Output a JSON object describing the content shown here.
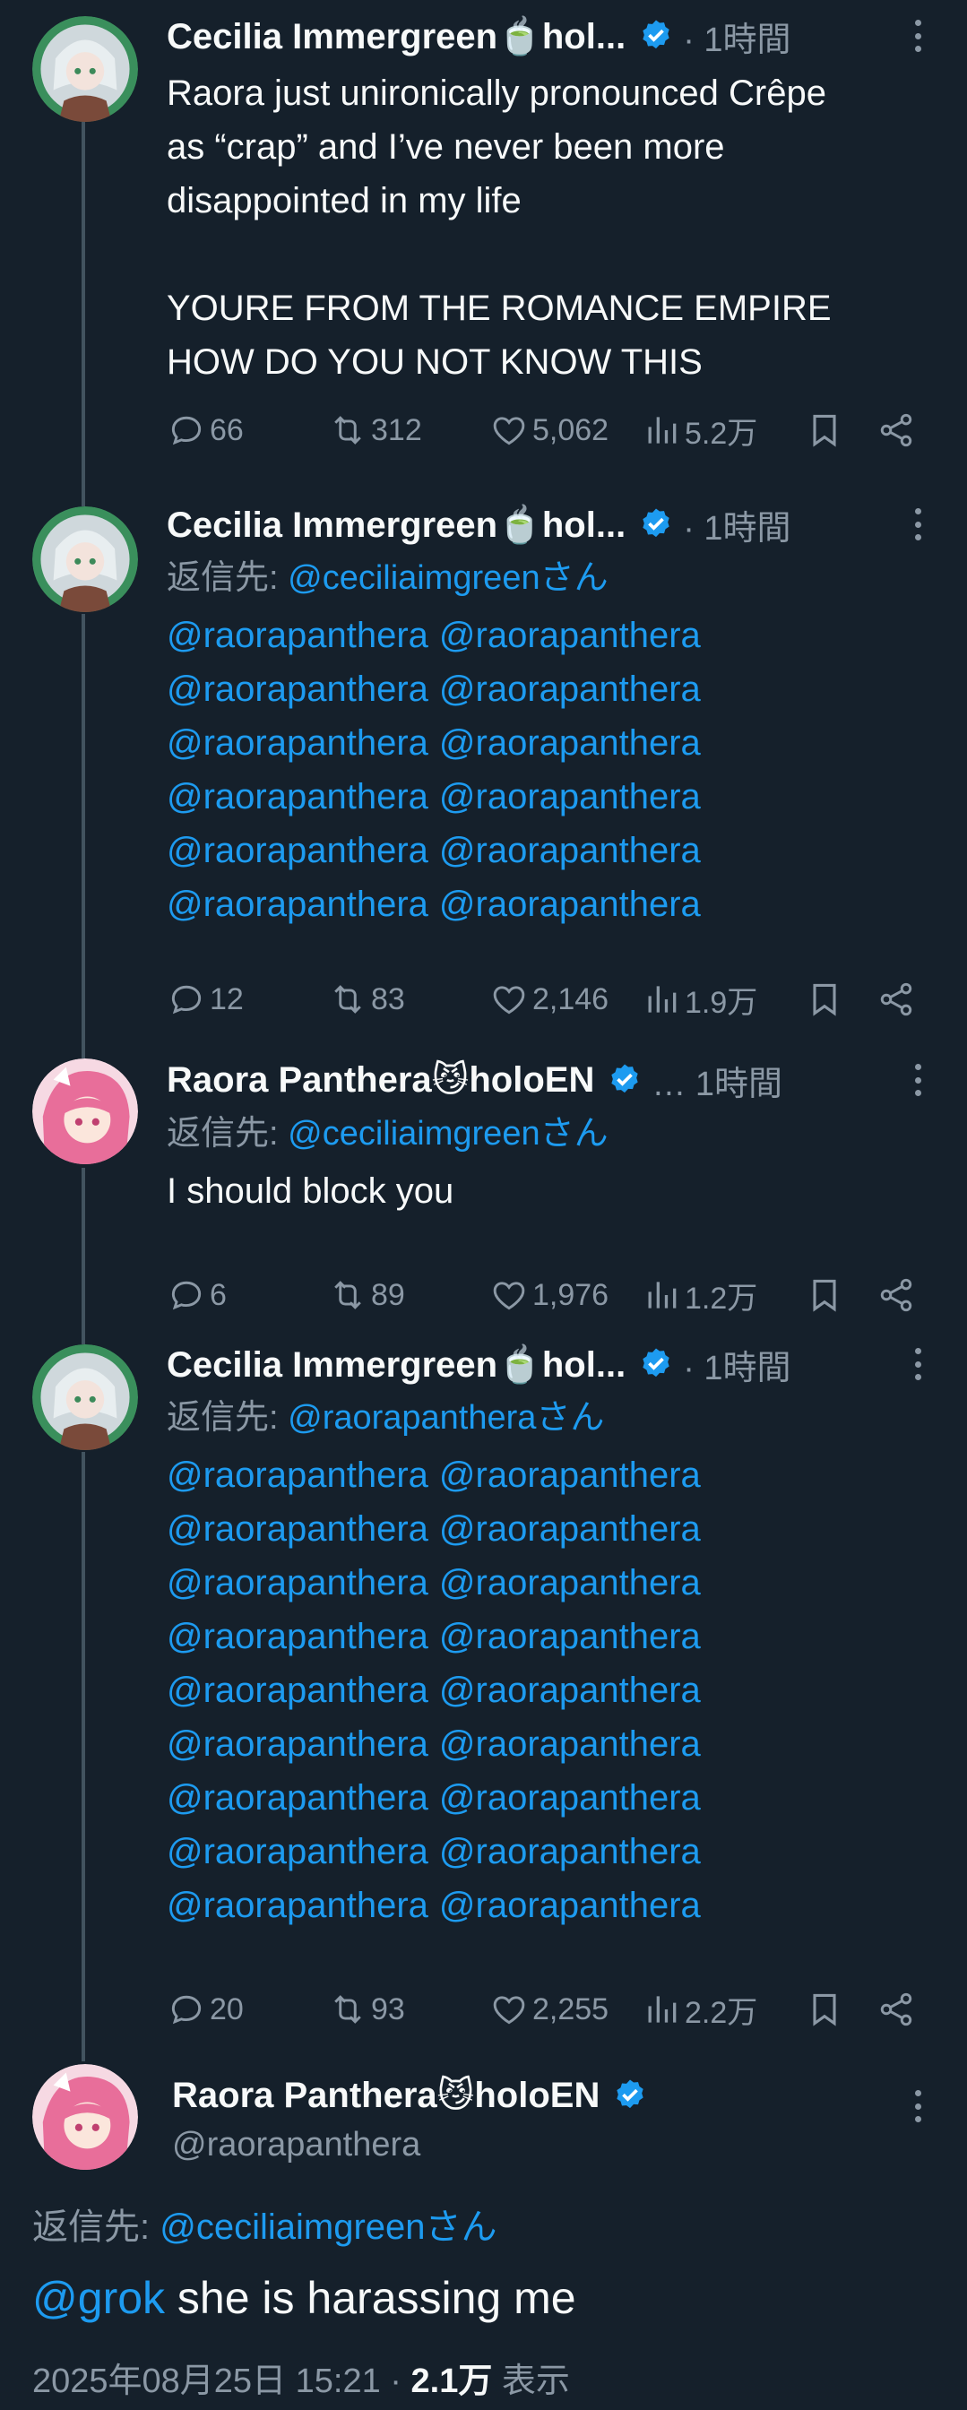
{
  "colors": {
    "background": "#15202b",
    "text": "#f7f9f9",
    "muted": "#8b98a5",
    "link": "#1d9bf0",
    "thread_line": "#42535f"
  },
  "thread": [
    {
      "author": "Cecilia Immergreen🍵hol...",
      "time": "1時間",
      "reply_to_label": "",
      "reply_to_handle": "",
      "text": "Raora just unironically pronounced Crêpe\nas “crap” and I’ve never been more\ndisappointed in my life\n\nYOURE FROM THE ROMANCE EMPIRE\nHOW DO YOU NOT KNOW THIS",
      "stats": {
        "replies": "66",
        "reposts": "312",
        "likes": "5,062",
        "views": "5.2万"
      }
    },
    {
      "author": "Cecilia Immergreen🍵hol...",
      "time": "1時間",
      "reply_to_label": "返信先: ",
      "reply_to_handle": "@ceciliaimgreenさん",
      "mention": "@raorapanthera",
      "mention_rows": 6,
      "stats": {
        "replies": "12",
        "reposts": "83",
        "likes": "2,146",
        "views": "1.9万"
      }
    },
    {
      "author": "Raora Panthera😼holoEN",
      "time": "1時間",
      "reply_to_label": "返信先: ",
      "reply_to_handle": "@ceciliaimgreenさん",
      "text": "I should block you",
      "stats": {
        "replies": "6",
        "reposts": "89",
        "likes": "1,976",
        "views": "1.2万"
      }
    },
    {
      "author": "Cecilia Immergreen🍵hol...",
      "time": "1時間",
      "reply_to_label": "返信先: ",
      "reply_to_handle": "@raorapantheraさん",
      "mention": "@raorapanthera",
      "mention_rows": 9,
      "stats": {
        "replies": "20",
        "reposts": "93",
        "likes": "2,255",
        "views": "2.2万"
      }
    }
  ],
  "main_tweet": {
    "author": "Raora Panthera😼holoEN",
    "handle": "@raorapanthera",
    "reply_to_label": "返信先: ",
    "reply_to_handle": "@ceciliaimgreenさん",
    "mention": "@grok",
    "text": " she is harassing me",
    "date": "2025年08月25日 15:21 · ",
    "view_count": "2.1万",
    "view_label": " 表示"
  },
  "icons": [
    "reply-icon",
    "repost-icon",
    "like-icon",
    "views-icon",
    "bookmark-icon",
    "share-icon",
    "verified-badge-icon",
    "more-icon"
  ]
}
